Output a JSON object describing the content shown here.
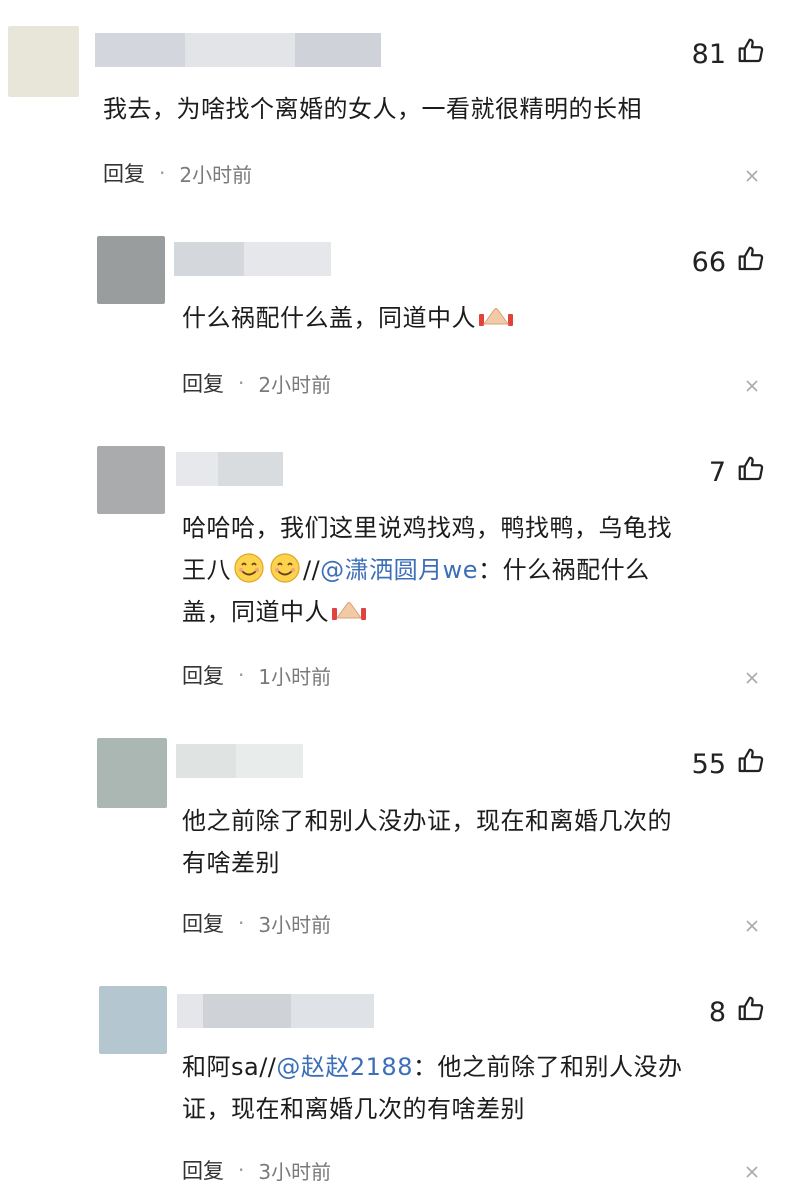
{
  "comments": [
    {
      "likes": "81",
      "text": "我去，为啥找个离婚的女人，一看就很精明的长相",
      "reply_label": "回复",
      "time": "2小时前"
    },
    {
      "likes": "66",
      "text": "什么祸配什么盖，同道中人",
      "reply_label": "回复",
      "time": "2小时前"
    },
    {
      "likes": "7",
      "text_line1": "哈哈哈，我们这里说鸡找鸡，鸭找鸭，乌龟找",
      "text_line2_start": "王八",
      "text_line2_sep": "//",
      "mention": "@潇洒圆月we",
      "text_line2_end": "：什么祸配什么",
      "text_line3": "盖，同道中人",
      "reply_label": "回复",
      "time": "1小时前"
    },
    {
      "likes": "55",
      "text_line1": "他之前除了和别人没办证，现在和离婚几次的",
      "text_line2": "有啥差别",
      "reply_label": "回复",
      "time": "3小时前"
    },
    {
      "likes": "8",
      "text_line1_start": "和阿sa//",
      "mention": "@赵赵2188",
      "text_line1_end": "：他之前除了和别人没办",
      "text_line2": "证，现在和离婚几次的有啥差别",
      "reply_label": "回复",
      "time": "3小时前"
    }
  ],
  "icons": {
    "like": "thumbs-up-icon",
    "close": "close-icon",
    "smile": "smile-emoji",
    "hands": "praying-hands-emoji"
  }
}
